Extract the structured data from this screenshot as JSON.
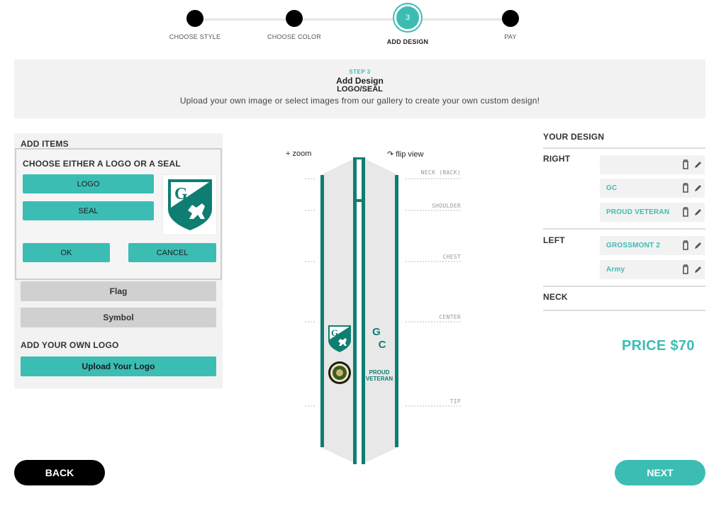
{
  "stepper": {
    "steps": [
      {
        "label": "CHOOSE STYLE",
        "num": ""
      },
      {
        "label": "CHOOSE COLOR",
        "num": ""
      },
      {
        "label": "ADD DESIGN",
        "num": "3"
      },
      {
        "label": "PAY",
        "num": ""
      }
    ],
    "active_index": 2
  },
  "banner": {
    "step_tag": "STEP 3",
    "title": "Add Design",
    "subtitle": "LOGO/SEAL",
    "description": "Upload your own image or select images from our gallery to create your own custom design!"
  },
  "left_panel": {
    "heading": "ADD ITEMS",
    "logo_seal": {
      "question": "CHOOSE EITHER A LOGO OR A SEAL",
      "logo_label": "LOGO",
      "seal_label": "SEAL",
      "ok_label": "OK",
      "cancel_label": "CANCEL",
      "preview_letter": "G"
    },
    "flag_label": "Flag",
    "symbol_label": "Symbol",
    "own_logo_heading": "ADD YOUR OWN LOGO",
    "upload_label": "Upload Your Logo"
  },
  "preview": {
    "zoom_label": "+ zoom",
    "flip_label": "flip view",
    "flip_icon": "rotate-icon",
    "zones": [
      "NECK (BACK)",
      "SHOULDER",
      "CHEST",
      "CENTER",
      "TIP"
    ],
    "right_text_1": "G",
    "right_text_2": "C",
    "right_text_3": "PROUD",
    "right_text_4": "VETERAN",
    "shield_letter": "G"
  },
  "design": {
    "heading": "YOUR DESIGN",
    "right_label": "RIGHT",
    "right_items": [
      "",
      "GC",
      "PROUD VETERAN"
    ],
    "left_label": "LEFT",
    "left_items": [
      "GROSSMONT 2",
      "Army"
    ],
    "neck_label": "NECK",
    "price": "PRICE $70"
  },
  "nav": {
    "back_label": "BACK",
    "next_label": "NEXT"
  },
  "colors": {
    "accent": "#3bbdb4",
    "dark_teal": "#0e7e72",
    "panel_bg": "#f2f2f2"
  }
}
